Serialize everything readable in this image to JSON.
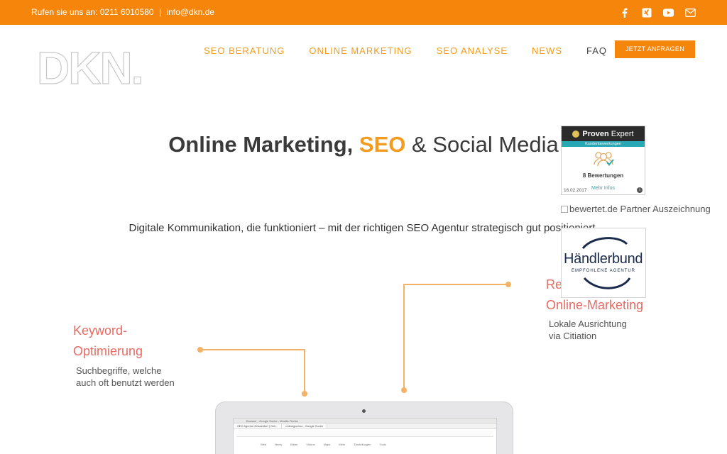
{
  "topbar": {
    "contact": [
      "Rufen sie uns an: 0211 6010580",
      "|",
      "info@dkn.de"
    ],
    "social_icons": [
      "facebook-icon",
      "xing-icon",
      "youtube-icon",
      "mail-icon"
    ]
  },
  "logo_text": "DKN.",
  "nav": {
    "items": [
      "SEO BERATUNG",
      "ONLINE MARKETING",
      "SEO ANALYSE",
      "NEWS",
      "FAQ"
    ],
    "cta": "JETZT ANFRAGEN"
  },
  "hero": {
    "title_part1": "Online Marketing,",
    "title_highlight": "SEO",
    "title_part2": "& Social Media",
    "subline": "Digitale Kommunikation, die funktioniert – mit der richtigen SEO Agentur strategisch gut positioniert"
  },
  "features": [
    {
      "title_line1": "Keyword-",
      "title_line2": "Optimierung",
      "desc_line1": "Suchbegriffe, welche",
      "desc_line2": "auch oft benutzt werden"
    },
    {
      "title_line1": "Re",
      "title_line2": "Online-Marketing",
      "desc_line1": "Lokale Ausrichtung",
      "desc_line2": "via Citiation"
    }
  ],
  "badges": {
    "provenexpert": {
      "brand_bold": "Proven",
      "brand_rest": "Expert",
      "subtitle": "Kundenbewertungen",
      "count": "8 Bewertungen",
      "more": "Mehr Infos",
      "date": "16.02.2017",
      "info": "i"
    },
    "bewertet_alt": "bewertet.de Partner Auszeichnung",
    "haendlerbund": {
      "name": "Händlerbund",
      "subtitle": "EMPFOHLENE AGENTUR"
    }
  },
  "laptop_screen": {
    "window_title": "Browser - Google Suche - Mozilla Firefox",
    "tabs": [
      "SEO Agentur Düsseldorf | Onli...",
      "onlinegoohoo - Google Suche"
    ],
    "links": [
      "Web",
      "News",
      "Bilder",
      "Videos",
      "Maps",
      "Mehr",
      "Einstellungen",
      "Tools"
    ]
  },
  "colors": {
    "accent": "#f6860b",
    "feature_title": "#e86a62",
    "line": "#f3b266"
  }
}
